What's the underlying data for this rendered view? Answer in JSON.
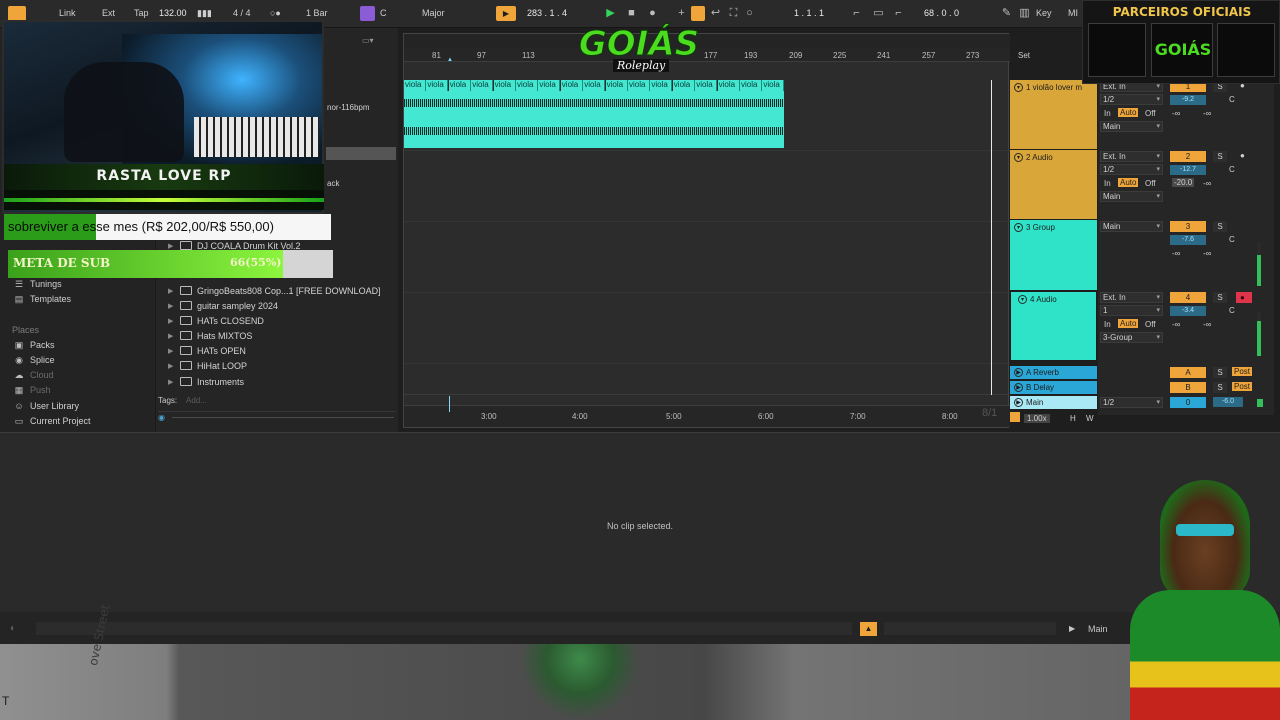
{
  "topbar": {
    "link": "Link",
    "ext": "Ext",
    "tap": "Tap",
    "tempo": "132.00",
    "meter": "4 / 4",
    "quantize": "1 Bar",
    "key": "C",
    "scale": "Major",
    "position": "283 .  1 .  4",
    "loop_start": "1 .  1 .  1",
    "loop_length": "68 .  0 .  0",
    "key_label": "Key",
    "midi_label": "MI"
  },
  "browser": {
    "places_label": "Places",
    "top_items": [
      {
        "icon": "tunings-icon",
        "label": "Tunings"
      },
      {
        "icon": "templates-icon",
        "label": "Templates"
      }
    ],
    "places": [
      {
        "icon": "packs-icon",
        "label": "Packs",
        "dim": false
      },
      {
        "icon": "splice-icon",
        "label": "Splice",
        "dim": false
      },
      {
        "icon": "cloud-icon",
        "label": "Cloud",
        "dim": true
      },
      {
        "icon": "push-icon",
        "label": "Push",
        "dim": true
      },
      {
        "icon": "user-library-icon",
        "label": "User Library",
        "dim": false
      },
      {
        "icon": "current-project-icon",
        "label": "Current Project",
        "dim": false
      }
    ],
    "folders": [
      "DJ COALA Drum Kit Vol.2",
      "GringoBeats808 Cop...1 [FREE DOWNLOAD]",
      "guitar sampley 2024",
      "HATs CLOSEND",
      "Hats MIXTOS",
      "HATs OPEN",
      "HiHat LOOP",
      "Instruments"
    ],
    "partial_right": "nor-116bpm",
    "partial_ack": "ack",
    "tags_label": "Tags:",
    "tags_placeholder": "Add..."
  },
  "arrangement": {
    "bar_numbers": [
      "81",
      "97",
      "113",
      "177",
      "193",
      "209",
      "225",
      "241",
      "257",
      "273"
    ],
    "set_label": "Set",
    "clip_label": "viola",
    "clip_count": 17,
    "time_marks": [
      "3:00",
      "4:00",
      "5:00",
      "6:00",
      "7:00",
      "8:00"
    ],
    "loop_marker": "8/1"
  },
  "tracks": [
    {
      "name": "1 violão lover m",
      "color": "#d9a63a",
      "input": "Ext. In",
      "channel": "1/2",
      "output": "Main",
      "number": "1",
      "volume": "-9.2",
      "pan": "C",
      "monitor": [
        "In",
        "Auto",
        "Off"
      ],
      "armed": false,
      "sends": [
        "-∞",
        "-∞"
      ]
    },
    {
      "name": "2 Audio",
      "color": "#d9a63a",
      "input": "Ext. In",
      "channel": "1/2",
      "output": "Main",
      "number": "2",
      "volume": "-12.7",
      "pan": "C",
      "monitor": [
        "In",
        "Auto",
        "Off"
      ],
      "armed": false,
      "sends": [
        "-20.0",
        "-∞"
      ]
    },
    {
      "name": "3 Group",
      "color": "#2fe3c8",
      "input": "",
      "channel": "",
      "output": "Main",
      "number": "3",
      "volume": "-7.6",
      "pan": "C",
      "monitor": [],
      "armed": false,
      "sends": [
        "-∞",
        "-∞"
      ]
    },
    {
      "name": "4 Audio",
      "color": "#2fe3c8",
      "input": "Ext. In",
      "channel": "1",
      "output": "3-Group",
      "number": "4",
      "volume": "-3.4",
      "pan": "C",
      "monitor": [
        "In",
        "Auto",
        "Off"
      ],
      "armed": true,
      "sends": [
        "-∞",
        "-∞"
      ]
    }
  ],
  "returns": [
    {
      "name": "A Reverb",
      "letter": "A",
      "post": "Post"
    },
    {
      "name": "B Delay",
      "letter": "B",
      "post": "Post"
    }
  ],
  "main_track": {
    "name": "Main",
    "channel": "1/2",
    "number": "0",
    "volume": "-6.0"
  },
  "zoom": "1.00x",
  "h_label": "H",
  "w_label": "W",
  "clipview": {
    "message": "No clip selected."
  },
  "status": {
    "main_label": "Main"
  },
  "overlay": {
    "channel_name": "RASTA LOVE RP",
    "goal_text": "sobreviver a esse mes (R$ 202,00/R$ 550,00)",
    "meta_label": "META DE SUB",
    "meta_value": "66(55%)",
    "meta_progress": 0.55,
    "partners_title": "PARCEIROS OFICIAIS",
    "goias_logo": "GOIÁS",
    "goias_sub": "Roleplay",
    "street_text": "ove Street"
  }
}
